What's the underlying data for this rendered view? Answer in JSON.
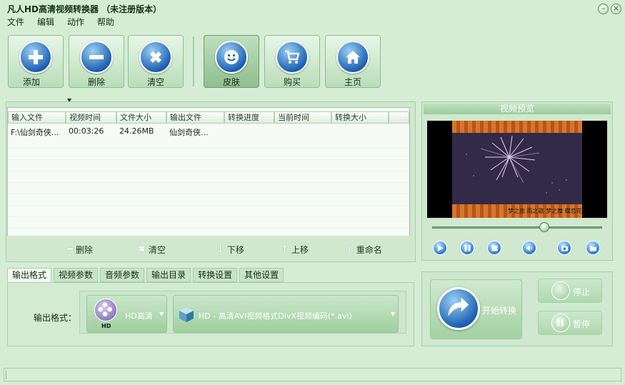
{
  "window": {
    "title": "凡人HD高清视频转换器 （未注册版本）",
    "min_glyph": "–",
    "close_glyph": "×"
  },
  "menu": [
    "文件",
    "编辑",
    "动作",
    "帮助"
  ],
  "toolbar": {
    "add": "添加",
    "delete": "删除",
    "clear": "清空",
    "skin": "皮肤",
    "buy": "购买",
    "home": "主页"
  },
  "file_table": {
    "columns": [
      "输入文件",
      "视频时间",
      "文件大小",
      "输出文件",
      "转换进度",
      "当前时间",
      "转换大小"
    ],
    "rows": [
      [
        "F:\\仙剑奇侠...",
        "00:03:26",
        "24.26MB",
        "仙剑奇侠...",
        "",
        "",
        ""
      ]
    ]
  },
  "list_actions": {
    "delete": "删除",
    "clear": "清空",
    "move_down": "下移",
    "move_up": "上移",
    "rename": "重命名"
  },
  "tabs": [
    "输出格式",
    "视频参数",
    "音频参数",
    "输出目录",
    "转换设置",
    "其他设置"
  ],
  "format": {
    "label": "输出格式：",
    "category": "HD高清",
    "category_badge": "HD",
    "profile": "HD - 高清AVI视频格式DivX视频编码(*.avi)"
  },
  "preview": {
    "title": "视频预览",
    "subtitle": "梦之旅 雨之歌 梦之舞 蝶恋花",
    "seek_position": 0.66
  },
  "convert": {
    "start": "开始转换",
    "stop": "停止",
    "pause": "暂停"
  },
  "colors": {
    "accent_blue": "#1e62b3",
    "panel_green": "#cfe8cf",
    "bg": "#d5ecd5"
  }
}
